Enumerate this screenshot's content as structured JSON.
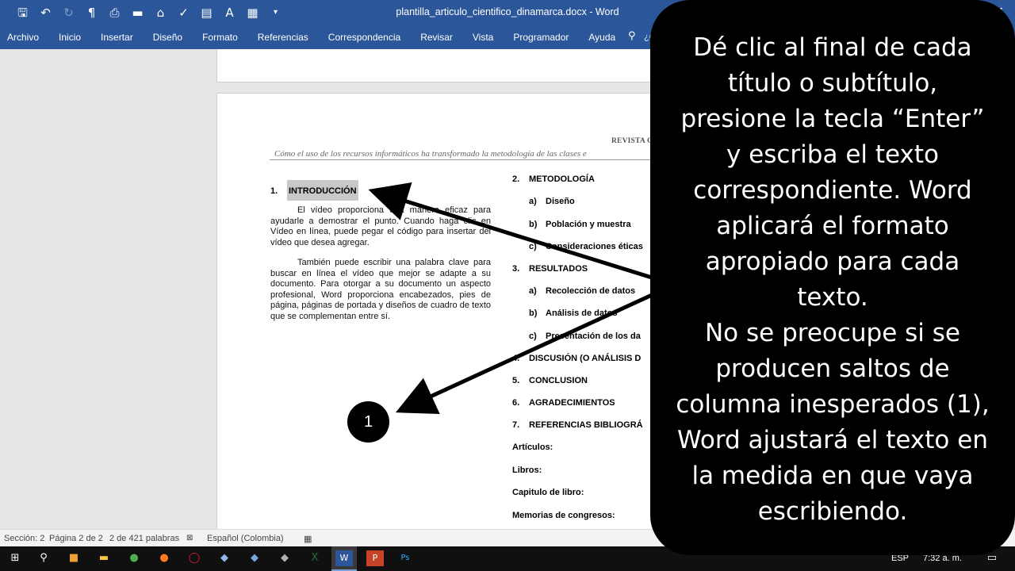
{
  "window": {
    "title": "plantilla_articulo_cientifico_dinamarca.docx  -  Word",
    "close_glyph": "✕"
  },
  "ribbon": {
    "tabs": [
      "Archivo",
      "Inicio",
      "Insertar",
      "Diseño",
      "Formato",
      "Referencias",
      "Correspondencia",
      "Revisar",
      "Vista",
      "Programador",
      "Ayuda"
    ],
    "search_fragment": "¿Q"
  },
  "document": {
    "header_right": "REVISTA C",
    "header_subtitle": "Cómo el uso de los recursos informáticos ha transformado la metodología de las clases e",
    "left_heading": {
      "num": "1.",
      "text": "INTRODUCCIÓN"
    },
    "paragraphs": [
      "El vídeo proporciona una manera eficaz para ayudarle a demostrar el punto. Cuando haga clic en Vídeo en línea, puede pegar el código para insertar del vídeo que desea agregar.",
      "También puede escribir una palabra clave para buscar en línea el vídeo que mejor se adapte a su documento. Para otorgar a su documento un aspecto profesional, Word proporciona encabezados, pies de página, páginas de portada y diseños de cuadro de texto que se complementan entre sí."
    ],
    "right_items": [
      {
        "num": "2.",
        "text": "METODOLOGÍA"
      },
      {
        "num": "a)",
        "text": "Diseño"
      },
      {
        "num": "b)",
        "text": "Población y muestra"
      },
      {
        "num": "c)",
        "text": "Consideraciones éticas"
      },
      {
        "num": "3.",
        "text": "RESULTADOS"
      },
      {
        "num": "a)",
        "text": "Recolección de datos"
      },
      {
        "num": "b)",
        "text": "Análisis de datos"
      },
      {
        "num": "c)",
        "text": "Presentación de los da"
      },
      {
        "num": "4.",
        "text": "DISCUSIÓN (O ANÁLISIS D"
      },
      {
        "num": "5.",
        "text": "CONCLUSION"
      },
      {
        "num": "6.",
        "text": "AGRADECIMIENTOS"
      },
      {
        "num": "7.",
        "text": "REFERENCIAS BIBLIOGRÁ"
      },
      {
        "num": "",
        "text": "Artículos:"
      },
      {
        "num": "",
        "text": "Libros:"
      },
      {
        "num": "",
        "text": "Capitulo de libro:"
      },
      {
        "num": "",
        "text": "Memorias de congresos:"
      }
    ]
  },
  "status": {
    "section": "Sección: 2",
    "page": "Página 2 de 2",
    "words": "2 de 421 palabras",
    "language": "Español (Colombia)",
    "zoom_fragment": "%"
  },
  "taskbar": {
    "lang": "ESP",
    "time": "7:32 a. m."
  },
  "callout": {
    "lines": [
      "Dé clic al final de cada",
      "título o subtítulo,",
      "presione la tecla “Enter”",
      "y escriba  el texto",
      "correspondiente. Word",
      "aplicará el formato",
      "apropiado para cada",
      "texto.",
      "No se preocupe si se",
      "producen saltos de",
      "columna inesperados (1),",
      "Word ajustará el texto en",
      "la medida en que vaya",
      "escribiendo."
    ]
  },
  "badge": {
    "label": "1"
  }
}
